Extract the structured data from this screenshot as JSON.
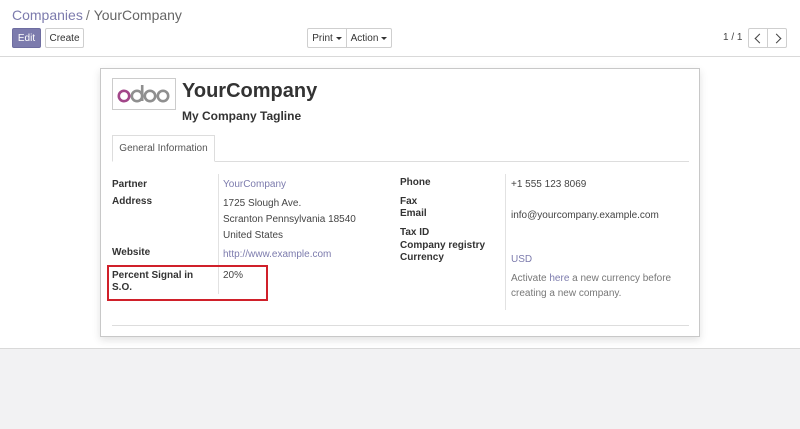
{
  "breadcrumb": {
    "parent": "Companies",
    "separator": "/",
    "current": "YourCompany"
  },
  "toolbar": {
    "edit_label": "Edit",
    "create_label": "Create",
    "print_label": "Print",
    "action_label": "Action"
  },
  "pager": {
    "value": "1 / 1"
  },
  "logo": {
    "text": "odoo",
    "colors": {
      "o": "#a24689",
      "d": "#8f8f8f"
    }
  },
  "company": {
    "name": "YourCompany",
    "tagline": "My Company Tagline"
  },
  "tabs": [
    {
      "label": "General Information"
    }
  ],
  "left_fields": {
    "partner_label": "Partner",
    "partner_value": "YourCompany",
    "address_label": "Address",
    "street": "1725 Slough Ave.",
    "city_line": "Scranton Pennsylvania 18540",
    "country": "United States",
    "website_label": "Website",
    "website_value": "http://www.example.com",
    "percent_label_line1": "Percent Signal in",
    "percent_label_line2": "S.O.",
    "percent_value": "20%"
  },
  "right_fields": {
    "phone_label": "Phone",
    "phone_value": "+1 555 123 8069",
    "fax_label": "Fax",
    "email_label": "Email",
    "email_value": "info@yourcompany.example.com",
    "taxid_label": "Tax ID",
    "registry_label": "Company registry",
    "currency_label": "Currency",
    "currency_value": "USD",
    "currency_help_before": "Activate ",
    "currency_help_link": "here",
    "currency_help_after": " a new currency before",
    "currency_help_line2": "creating a new company."
  },
  "colors": {
    "brand": "#7c7bad",
    "highlight": "#d0202a"
  }
}
